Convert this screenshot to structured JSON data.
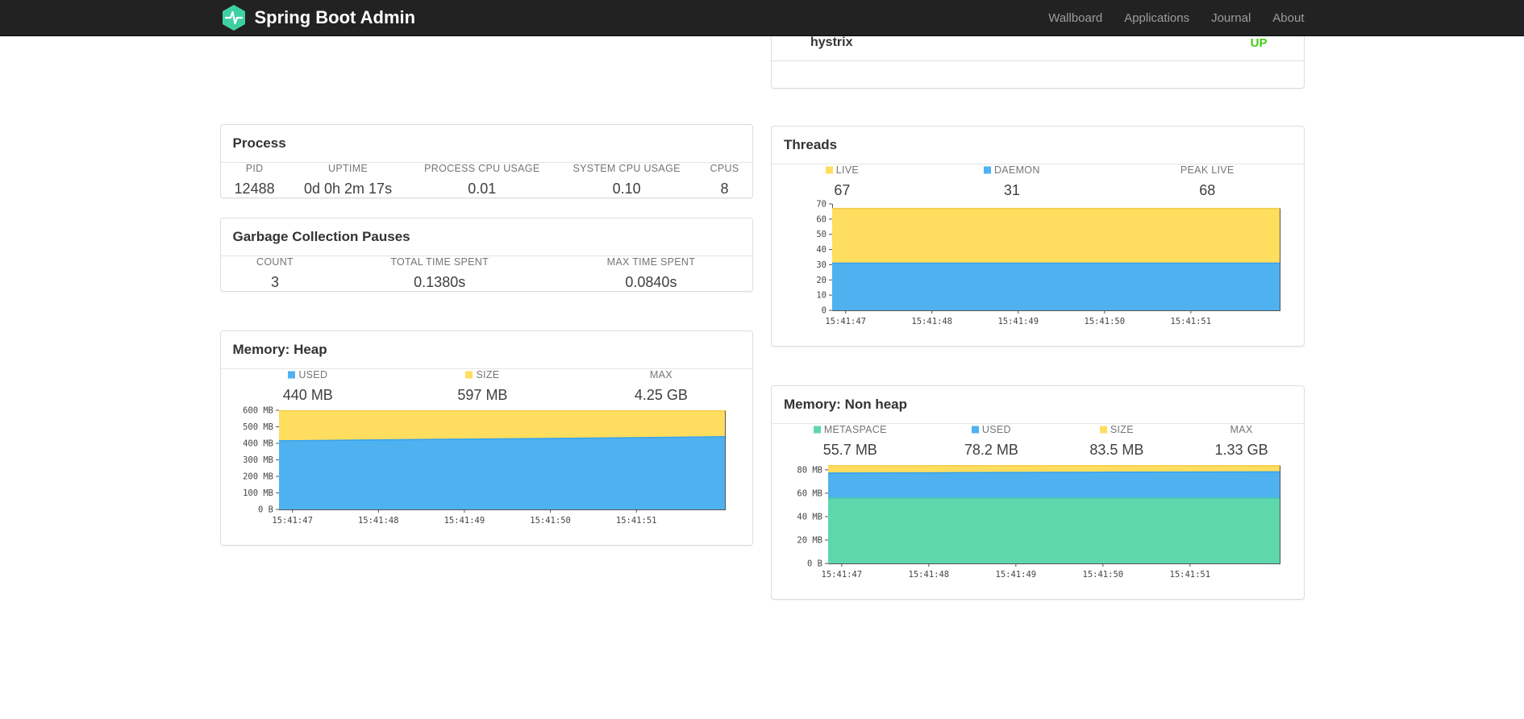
{
  "navbar": {
    "brand": "Spring Boot Admin",
    "brand_color": "#3fd0a2",
    "links": [
      {
        "label": "Wallboard"
      },
      {
        "label": "Applications"
      },
      {
        "label": "Journal"
      },
      {
        "label": "About"
      }
    ]
  },
  "application_panel": {
    "name": "hystrix",
    "status": "UP",
    "status_color": "#44cc11"
  },
  "process": {
    "title": "Process",
    "stats": [
      {
        "label": "PID",
        "value": "12488"
      },
      {
        "label": "UPTIME",
        "value": "0d 0h 2m 17s"
      },
      {
        "label": "PROCESS CPU USAGE",
        "value": "0.01"
      },
      {
        "label": "SYSTEM CPU USAGE",
        "value": "0.10"
      },
      {
        "label": "CPUS",
        "value": "8"
      }
    ]
  },
  "gc": {
    "title": "Garbage Collection Pauses",
    "stats": [
      {
        "label": "COUNT",
        "value": "3"
      },
      {
        "label": "TOTAL TIME SPENT",
        "value": "0.1380s"
      },
      {
        "label": "MAX TIME SPENT",
        "value": "0.0840s"
      }
    ]
  },
  "threads": {
    "title": "Threads",
    "legend": [
      {
        "label": "LIVE",
        "value": "67",
        "swatch": "#FFDD5F"
      },
      {
        "label": "DAEMON",
        "value": "31",
        "swatch": "#4FB1F0"
      },
      {
        "label": "PEAK LIVE",
        "value": "68",
        "swatch": null
      }
    ]
  },
  "memory_heap": {
    "title": "Memory: Heap",
    "legend": [
      {
        "label": "USED",
        "value": "440 MB",
        "swatch": "#4FB1F0"
      },
      {
        "label": "SIZE",
        "value": "597 MB",
        "swatch": "#FFDD5F"
      },
      {
        "label": "MAX",
        "value": "4.25 GB",
        "swatch": null
      }
    ]
  },
  "memory_nonheap": {
    "title": "Memory: Non heap",
    "legend": [
      {
        "label": "METASPACE",
        "value": "55.7 MB",
        "swatch": "#5FD7AD"
      },
      {
        "label": "USED",
        "value": "78.2 MB",
        "swatch": "#4FB1F0"
      },
      {
        "label": "SIZE",
        "value": "83.5 MB",
        "swatch": "#FFDD5F"
      },
      {
        "label": "MAX",
        "value": "1.33 GB",
        "swatch": null
      }
    ]
  },
  "chart_data": [
    {
      "id": "threads",
      "type": "area",
      "title": "Threads",
      "xlabel": "",
      "ylabel": "",
      "ylim": [
        0,
        70
      ],
      "grid": false,
      "legend_position": "top",
      "x_labels": [
        "15:41:47",
        "15:41:48",
        "15:41:49",
        "15:41:50",
        "15:41:51"
      ],
      "x_label_fractions": [
        0.03,
        0.2225,
        0.415,
        0.6075,
        0.8
      ],
      "yticks": [
        {
          "v": 0,
          "label": "0"
        },
        {
          "v": 10,
          "label": "10"
        },
        {
          "v": 20,
          "label": "20"
        },
        {
          "v": 30,
          "label": "30"
        },
        {
          "v": 40,
          "label": "40"
        },
        {
          "v": 50,
          "label": "50"
        },
        {
          "v": 60,
          "label": "60"
        },
        {
          "v": 70,
          "label": "70"
        }
      ],
      "layers": [
        {
          "name": "LIVE",
          "fill": "#FFDD5F",
          "edge": "#F3CD49",
          "values": [
            67,
            67,
            67,
            67,
            67,
            67
          ]
        },
        {
          "name": "DAEMON",
          "fill": "#4FB1F0",
          "edge": "#36A2EC",
          "values": [
            31,
            31,
            31,
            31,
            31,
            31
          ]
        }
      ],
      "legend": [
        {
          "label": "LIVE",
          "value": 67
        },
        {
          "label": "DAEMON",
          "value": 31
        },
        {
          "label": "PEAK LIVE",
          "value": 68
        }
      ]
    },
    {
      "id": "memory-heap",
      "type": "area",
      "title": "Memory: Heap",
      "xlabel": "",
      "ylabel": "",
      "ylim": [
        0,
        600
      ],
      "grid": false,
      "legend_position": "top",
      "x_labels": [
        "15:41:47",
        "15:41:48",
        "15:41:49",
        "15:41:50",
        "15:41:51"
      ],
      "x_label_fractions": [
        0.03,
        0.2225,
        0.415,
        0.6075,
        0.8
      ],
      "yticks": [
        {
          "v": 0,
          "label": "0 B"
        },
        {
          "v": 100,
          "label": "100 MB"
        },
        {
          "v": 200,
          "label": "200 MB"
        },
        {
          "v": 300,
          "label": "300 MB"
        },
        {
          "v": 400,
          "label": "400 MB"
        },
        {
          "v": 500,
          "label": "500 MB"
        },
        {
          "v": 600,
          "label": "600 MB"
        }
      ],
      "layers": [
        {
          "name": "SIZE",
          "fill": "#FFDD5F",
          "edge": "#F3CD49",
          "values": [
            597,
            597,
            597,
            597,
            597,
            597
          ]
        },
        {
          "name": "USED",
          "fill": "#4FB1F0",
          "edge": "#36A2EC",
          "values": [
            415,
            420,
            425,
            429,
            434,
            440
          ]
        }
      ],
      "legend": [
        {
          "label": "USED",
          "value": "440 MB"
        },
        {
          "label": "SIZE",
          "value": "597 MB"
        },
        {
          "label": "MAX",
          "value": "4.25 GB"
        }
      ]
    },
    {
      "id": "memory-nonheap",
      "type": "area",
      "title": "Memory: Non heap",
      "xlabel": "",
      "ylabel": "",
      "ylim": [
        0,
        84
      ],
      "grid": false,
      "legend_position": "top",
      "x_labels": [
        "15:41:47",
        "15:41:48",
        "15:41:49",
        "15:41:50",
        "15:41:51"
      ],
      "x_label_fractions": [
        0.03,
        0.2225,
        0.415,
        0.6075,
        0.8
      ],
      "yticks": [
        {
          "v": 0,
          "label": "0 B"
        },
        {
          "v": 20,
          "label": "20 MB"
        },
        {
          "v": 40,
          "label": "40 MB"
        },
        {
          "v": 60,
          "label": "60 MB"
        },
        {
          "v": 80,
          "label": "80 MB"
        }
      ],
      "layers": [
        {
          "name": "SIZE",
          "fill": "#FFDD5F",
          "edge": "#F3CD49",
          "values": [
            83.5,
            83.5,
            83.5,
            83.5,
            83.5,
            83.5
          ]
        },
        {
          "name": "USED",
          "fill": "#4FB1F0",
          "edge": "#36A2EC",
          "values": [
            77.2,
            77.4,
            77.7,
            77.9,
            78.1,
            78.2
          ]
        },
        {
          "name": "METASPACE",
          "fill": "#5FD7AD",
          "edge": "#46CFA0",
          "values": [
            55.7,
            55.7,
            55.7,
            55.7,
            55.7,
            55.7
          ]
        }
      ],
      "legend": [
        {
          "label": "METASPACE",
          "value": "55.7 MB"
        },
        {
          "label": "USED",
          "value": "78.2 MB"
        },
        {
          "label": "SIZE",
          "value": "83.5 MB"
        },
        {
          "label": "MAX",
          "value": "1.33 GB"
        }
      ]
    }
  ]
}
